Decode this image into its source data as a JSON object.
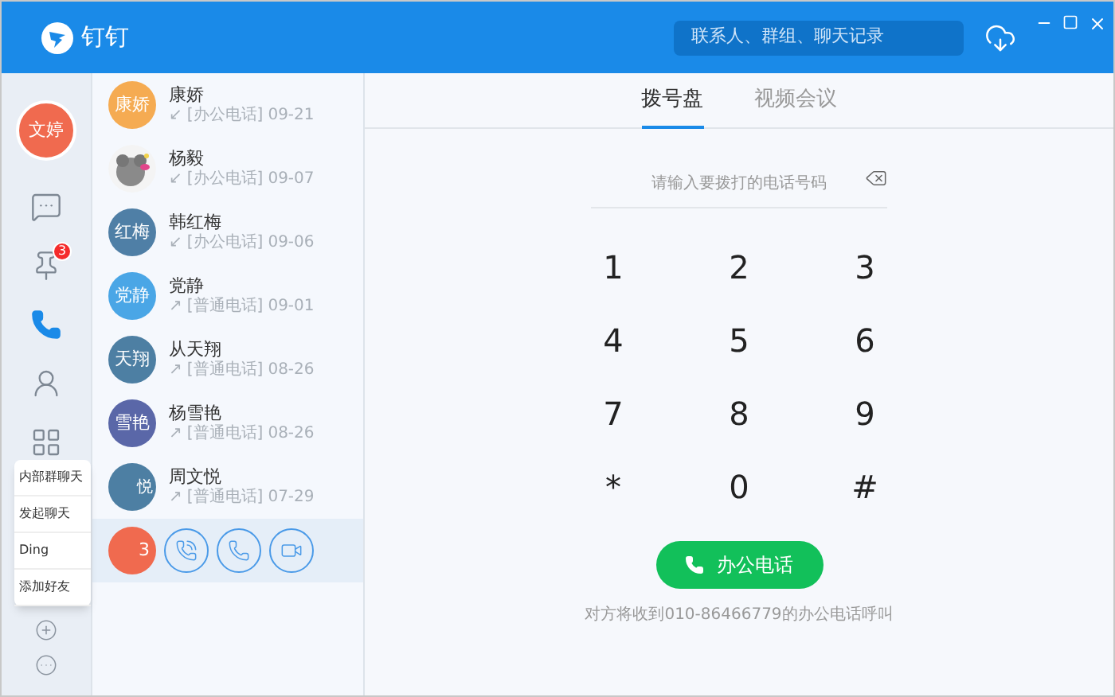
{
  "app": {
    "name": "钉钉"
  },
  "search": {
    "placeholder": "联系人、群组、聊天记录"
  },
  "rail": {
    "user_avatar": "文婷",
    "items": [
      {
        "kind": "chat",
        "selected": false
      },
      {
        "kind": "pin",
        "selected": false,
        "badge": "3"
      },
      {
        "kind": "phone",
        "selected": true
      },
      {
        "kind": "contacts",
        "selected": false
      },
      {
        "kind": "apps",
        "selected": false
      }
    ]
  },
  "calls": [
    {
      "kind": "text",
      "selected": false,
      "avatar_text": "康娇",
      "color": "#f5ab52",
      "name": "康娇",
      "arrow": "↙",
      "type": "[办公电话]",
      "date": "09-21"
    },
    {
      "kind": "picture",
      "selected": false,
      "name": "杨毅",
      "arrow": "↙",
      "type": "[办公电话]",
      "date": "09-07"
    },
    {
      "kind": "text",
      "selected": false,
      "avatar_text": "红梅",
      "color": "#4f7fa6",
      "name": "韩红梅",
      "arrow": "↙",
      "type": "[办公电话]",
      "date": "09-06"
    },
    {
      "kind": "text",
      "selected": false,
      "avatar_text": "党静",
      "color": "#4aa6e6",
      "name": "党静",
      "arrow": "↗",
      "type": "[普通电话]",
      "date": "09-01"
    },
    {
      "kind": "text",
      "selected": false,
      "avatar_text": "天翔",
      "color": "#4d7fa3",
      "name": "从天翔",
      "arrow": "↗",
      "type": "[普通电话]",
      "date": "08-26"
    },
    {
      "kind": "text",
      "selected": false,
      "avatar_text": "雪艳",
      "color": "#5a67a8",
      "name": "杨雪艳",
      "arrow": "↗",
      "type": "[普通电话]",
      "date": "08-26"
    },
    {
      "kind": "text",
      "selected": false,
      "avatar_text": "悦",
      "color": "#4d7fa3",
      "name": "周文悦",
      "arrow": "↗",
      "type": "[普通电话]",
      "date": "07-29"
    },
    {
      "kind": "actions",
      "selected": true,
      "avatar_text": "3",
      "color": "#f06a4f"
    }
  ],
  "menu": [
    "内部群聊天",
    "发起聊天",
    "Ding",
    "添加好友"
  ],
  "tabs": [
    {
      "label": "拨号盘",
      "selected": true
    },
    {
      "label": "视频会议",
      "selected": false
    }
  ],
  "dial": {
    "placeholder": "请输入要拨打的电话号码",
    "keys": [
      "1",
      "2",
      "3",
      "4",
      "5",
      "6",
      "7",
      "8",
      "9",
      "*",
      "0",
      "#"
    ],
    "call_button": "办公电话",
    "note": "对方将收到010-86466779的办公电话呼叫"
  }
}
